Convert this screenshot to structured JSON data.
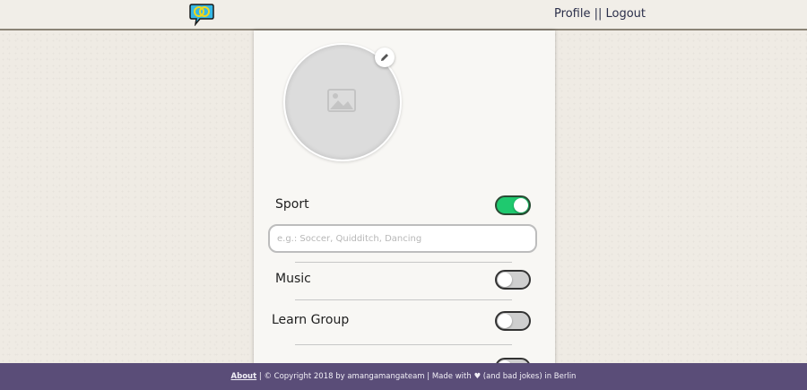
{
  "header": {
    "profile_link": "Profile",
    "separator": " || ",
    "logout_link": "Logout"
  },
  "profile": {
    "avatar_icon": "image-placeholder-icon",
    "edit_icon": "pencil-icon"
  },
  "interests": [
    {
      "label": "Sport",
      "enabled": true
    },
    {
      "label": "Music",
      "enabled": false
    },
    {
      "label": "Learn Group",
      "enabled": false
    }
  ],
  "sport_input": {
    "value": "",
    "placeholder": "e.g.: Soccer, Quidditch, Dancing"
  },
  "footer": {
    "about": "About",
    "copyright": " | © Copyright 2018 by amangamangateam | Made with ",
    "heart": "♥",
    "tail": " (and bad jokes) in Berlin"
  },
  "colors": {
    "toggle_on": "#1fc96f",
    "footer_bg": "#5a4d78",
    "page_bg": "#efebe4"
  }
}
